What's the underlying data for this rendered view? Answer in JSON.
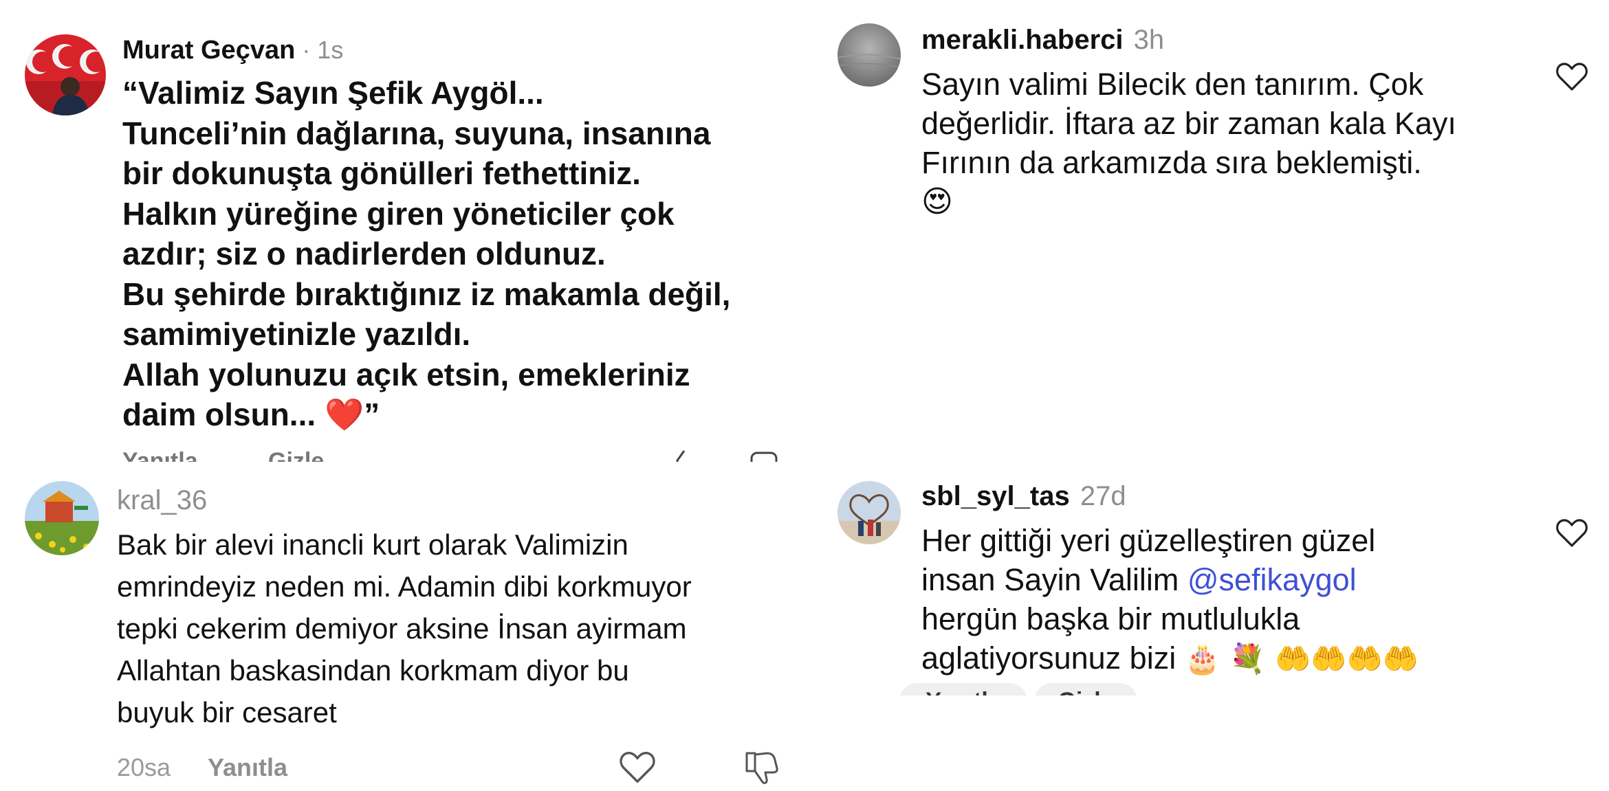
{
  "comment1": {
    "username": "Murat Geçvan",
    "time": " · 1s",
    "lines": [
      "“Valimiz Sayın Şefik Aygöl...",
      "Tunceli’nin dağlarına, suyuna, insanına",
      "bir dokunuşta gönülleri fethettiniz.",
      "Halkın yüreğine giren yöneticiler çok",
      "azdır; siz o nadirlerden oldunuz.",
      "Bu şehirde bıraktığınız iz makamla değil,",
      "samimiyetinizle yazıldı.",
      "Allah yolunuzu açık etsin, emekleriniz",
      "daim olsun... "
    ],
    "closing_emoji": "❤️",
    "closing_quote": "”",
    "reply_label": "Yanıtla",
    "hide_label": "Gizle"
  },
  "comment2": {
    "username": "merakli.haberci",
    "time": "3h",
    "lines": [
      "Sayın valimi Bilecik den tanırım. Çok",
      "değerlidir. İftara az bir zaman kala Kayı",
      "Fırının da arkamızda sıra beklemişti."
    ],
    "emoji": "😍"
  },
  "comment3": {
    "username": "kral_36",
    "lines": [
      "Bak bir alevi inancli kurt olarak Valimizin",
      "emrindeyiz neden mi. Adamin dibi korkmuyor",
      "tepki cekerim demiyor aksine İnsan ayirmam",
      "Allahtan baskasindan korkmam diyor bu",
      "buyuk bir cesaret"
    ],
    "time": "20sa",
    "reply_label": "Yanıtla"
  },
  "comment4": {
    "username": "sbl_syl_tas",
    "time": "27d",
    "line1": "Her gittiği yeri güzelleştiren güzel",
    "line2_text": "insan Sayin Valilim ",
    "mention": "@sefikaygol",
    "line3": "hergün başka bir mutlulukla",
    "line4_text": "aglatiyorsunuz bizi ",
    "emojis": "🎂 💐 🤲🤲🤲🤲",
    "reply_label": "Yanıtla",
    "hide_label": "Gizle"
  },
  "colors": {
    "text": "#111111",
    "muted": "#8e8e8e",
    "mention": "#3f4fd6",
    "flag_red": "#d8232a"
  },
  "icons": [
    "heart-icon",
    "dislike-icon"
  ]
}
